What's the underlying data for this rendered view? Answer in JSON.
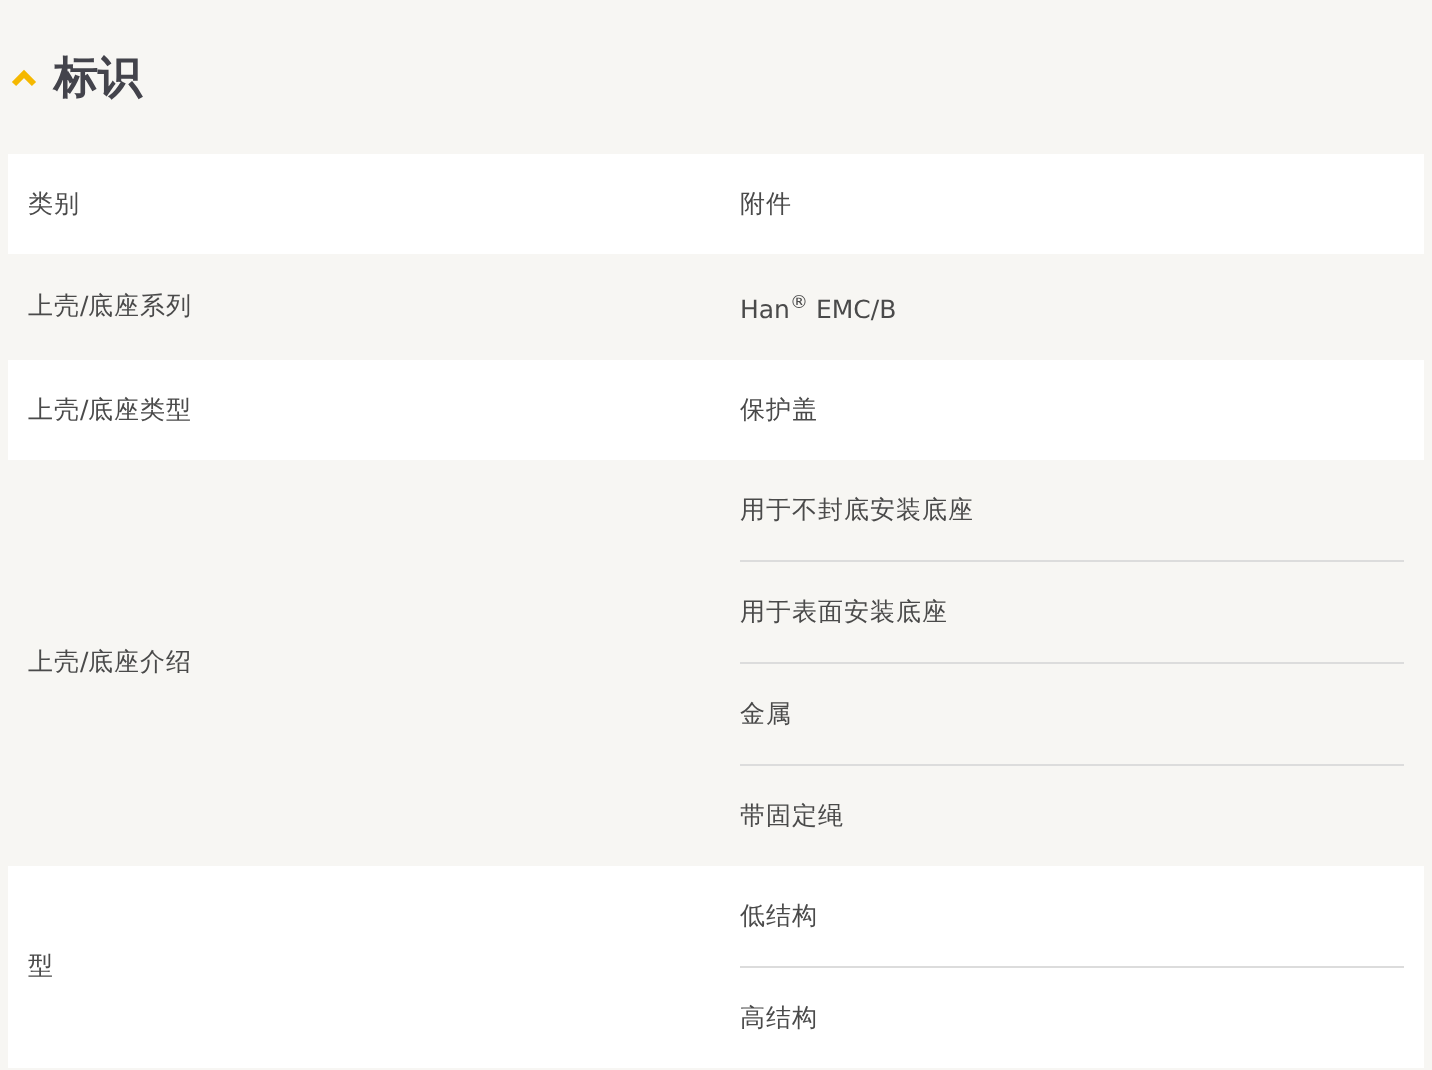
{
  "section": {
    "title": "标识",
    "expanded": true
  },
  "rows": [
    {
      "label": "类别",
      "values": [
        "附件"
      ]
    },
    {
      "label": "上壳/底座系列",
      "values": [
        "Han$^{®}$ EMC/B"
      ]
    },
    {
      "label": "上壳/底座类型",
      "values": [
        "保护盖"
      ]
    },
    {
      "label": "上壳/底座介绍",
      "values": [
        "用于不封底安装底座",
        "用于表面安装底座",
        "金属",
        "带固定绳"
      ]
    },
    {
      "label": "型",
      "values": [
        "低结构",
        "高结构"
      ]
    }
  ]
}
